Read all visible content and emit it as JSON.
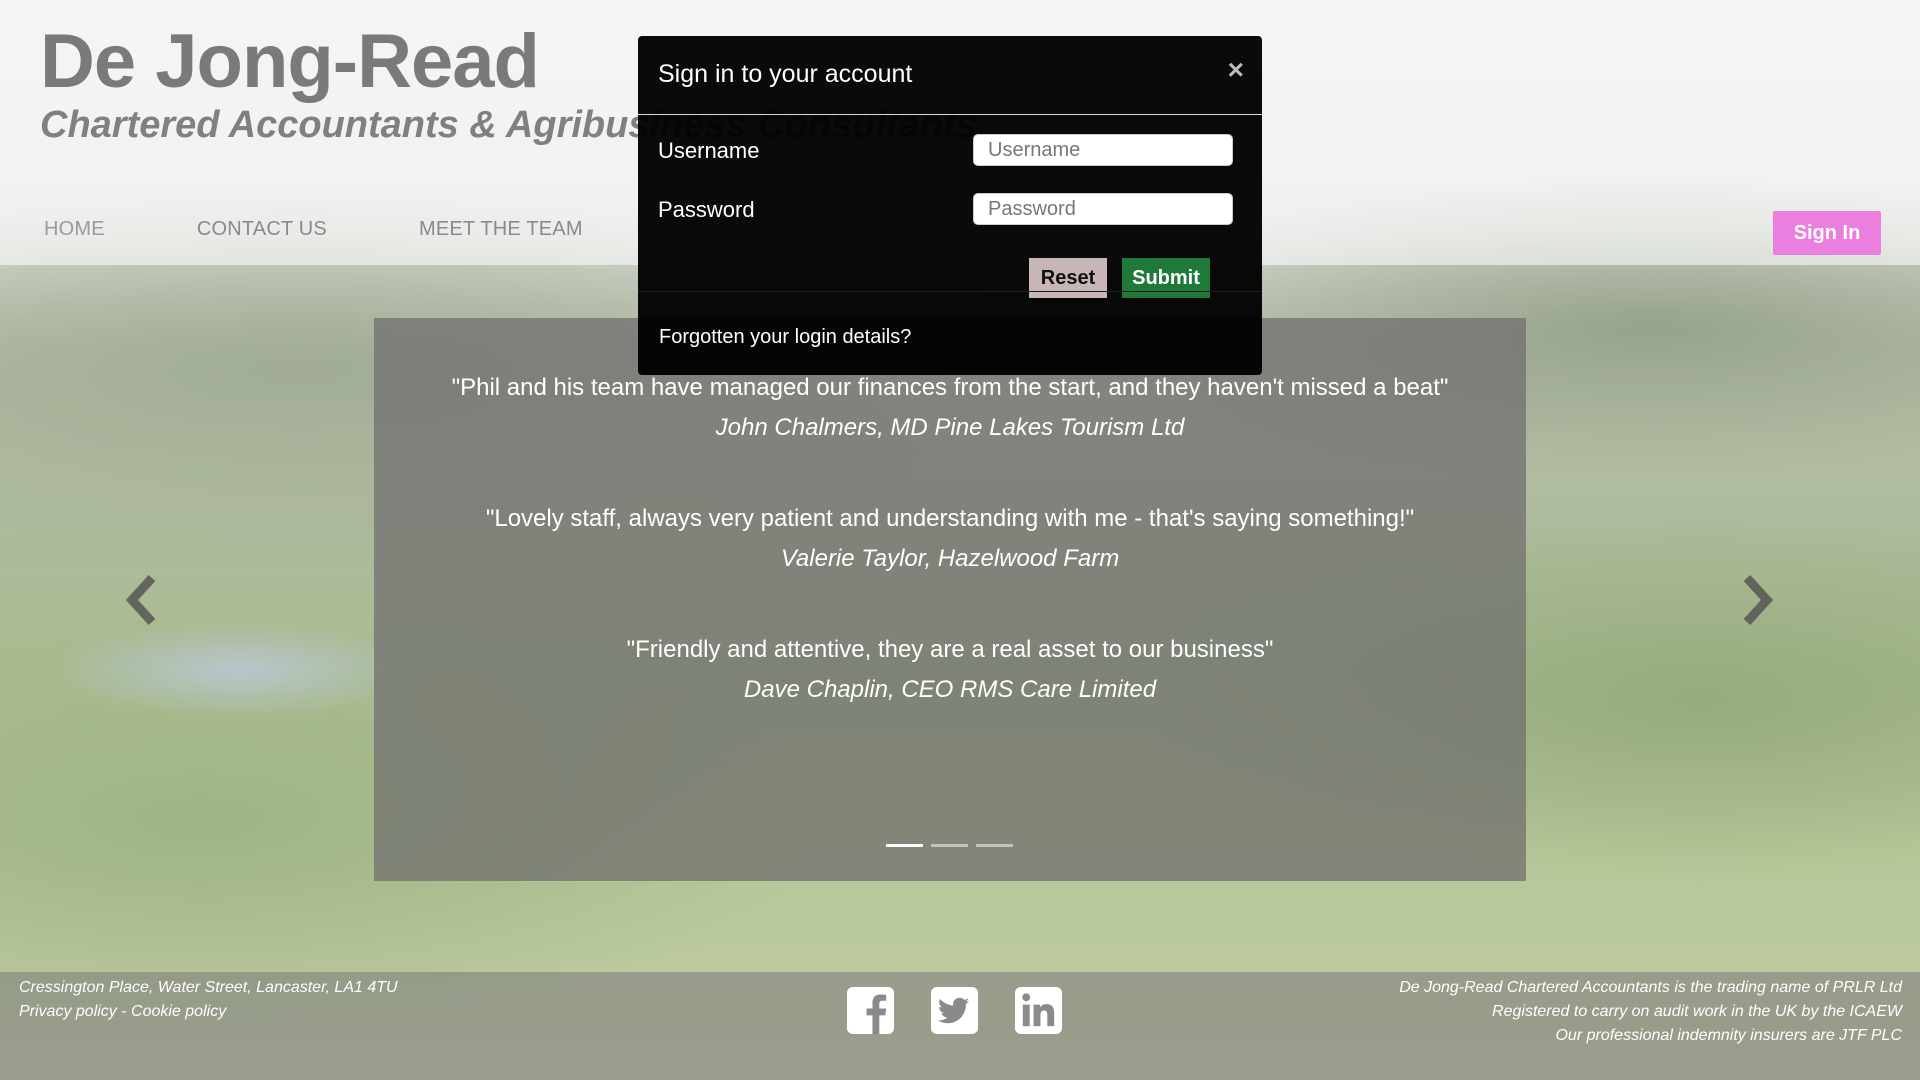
{
  "site": {
    "title": "De Jong-Read",
    "subtitle": "Chartered Accountants & Agribusiness Consultants"
  },
  "nav": {
    "items": [
      {
        "label": "HOME"
      },
      {
        "label": "CONTACT US"
      },
      {
        "label": "MEET THE TEAM"
      }
    ],
    "sign_in_label": "Sign In"
  },
  "testimonials": [
    {
      "quote": "\"Phil and his team have managed our finances from the start, and they haven't missed a beat\"",
      "author": "John Chalmers, MD Pine Lakes Tourism Ltd"
    },
    {
      "quote": "\"Lovely staff, always very patient and understanding with me - that's saying something!\"",
      "author": "Valerie Taylor, Hazelwood Farm"
    },
    {
      "quote": "\"Friendly and attentive, they are a real asset to our business\"",
      "author": "Dave Chaplin, CEO RMS Care Limited"
    }
  ],
  "carousel": {
    "slide_count": 3,
    "active_index": 0,
    "prev_icon": "chevron-left-icon",
    "next_icon": "chevron-right-icon"
  },
  "footer": {
    "address": "Cressington Place, Water Street, Lancaster, LA1 4TU",
    "privacy_link": "Privacy policy",
    "separator": " - ",
    "cookie_link": "Cookie policy",
    "legal_lines": [
      "De Jong-Read Chartered Accountants is the trading name of PRLR Ltd",
      "Registered to carry on audit work in the UK by the ICAEW",
      "Our professional indemnity insurers are JTF PLC"
    ],
    "social": [
      "facebook-icon",
      "twitter-icon",
      "linkedin-icon"
    ]
  },
  "modal": {
    "title": "Sign in to your account",
    "close_symbol": "×",
    "username_label": "Username",
    "username_placeholder": "Username",
    "username_value": "",
    "password_label": "Password",
    "password_placeholder": "Password",
    "password_value": "",
    "reset_label": "Reset",
    "submit_label": "Submit",
    "forgot_link": "Forgotten your login details?"
  },
  "colors": {
    "sign_in_accent": "#ea7fe0",
    "submit_green": "#1f7a3a",
    "reset_gray": "#c8b6b6"
  }
}
